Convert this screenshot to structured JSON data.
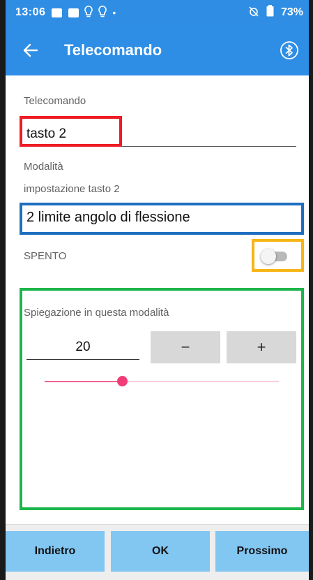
{
  "status_bar": {
    "time": "13:06",
    "battery": "73%",
    "icons": [
      "image-icon",
      "app-icon",
      "bulb-icon",
      "bulb-icon",
      "dot-icon",
      "no-alarm-icon",
      "battery-icon"
    ]
  },
  "app_bar": {
    "title": "Telecomando",
    "back_icon": "arrow-left-icon",
    "bluetooth_icon": "bluetooth-icon",
    "color": "#2e8ee6"
  },
  "form": {
    "telecomando_label": "Telecomando",
    "telecomando_value": "tasto 2",
    "modalita_label": "Modalità",
    "impostazione_label": "impostazione tasto 2",
    "mode_value": "2 limite angolo di flessione",
    "toggle_label": "SPENTO",
    "toggle_on": false,
    "explanation_label": "Spiegazione in questa modalità",
    "number_value": "20",
    "minus_label": "−",
    "plus_label": "+",
    "slider_fraction": 0.33
  },
  "annotations": {
    "red": "#ee1c24",
    "blue": "#1f6fc0",
    "yellow": "#f7b516",
    "green": "#1db54c"
  },
  "bottom_bar": {
    "back_label": "Indietro",
    "ok_label": "OK",
    "next_label": "Prossimo",
    "button_color": "#82c6f2"
  }
}
